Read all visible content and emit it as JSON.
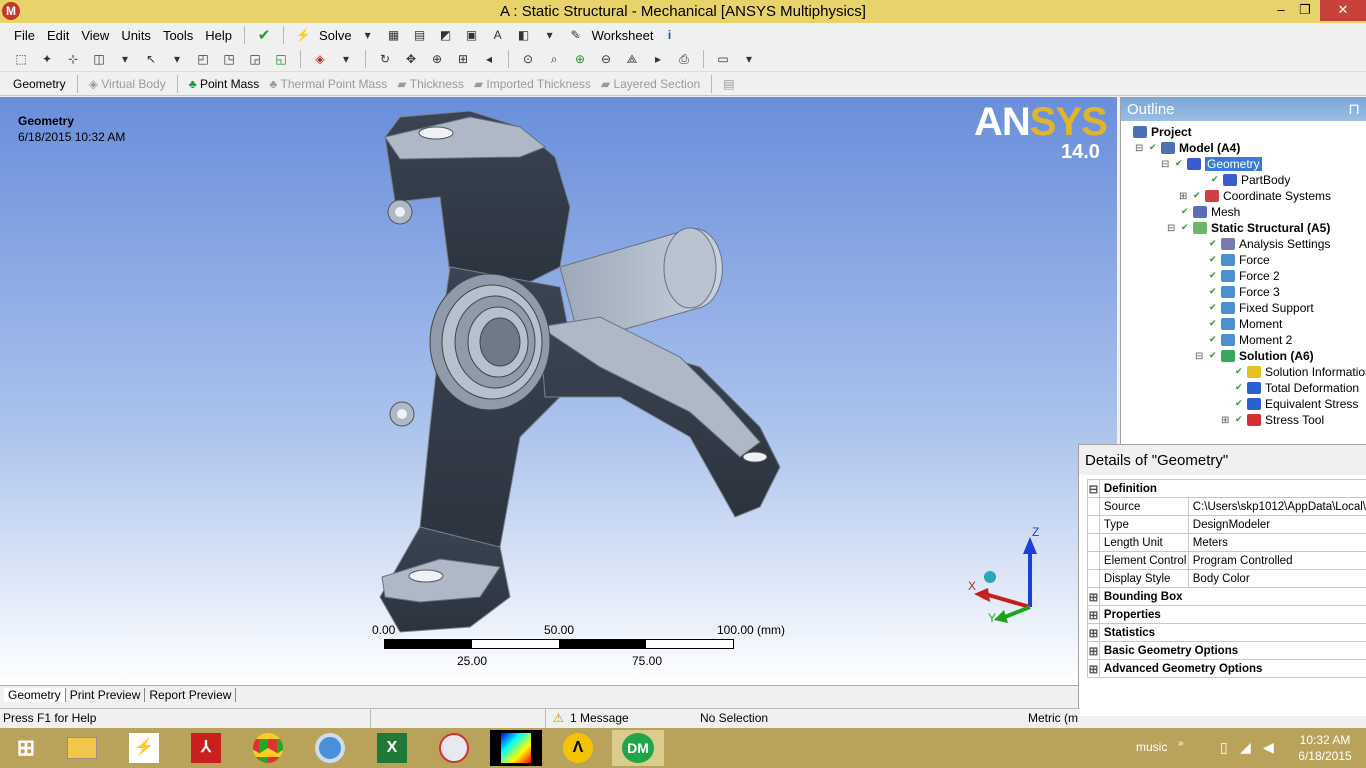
{
  "window": {
    "title": "A : Static Structural - Mechanical [ANSYS Multiphysics]",
    "minimize": "–",
    "maximize": "❐",
    "close": "✕"
  },
  "menu": [
    "File",
    "Edit",
    "View",
    "Units",
    "Tools",
    "Help"
  ],
  "toolbar1": {
    "solve_label": "Solve",
    "worksheet_label": "Worksheet"
  },
  "context": {
    "geometry": "Geometry",
    "virtual_body": "Virtual Body",
    "point_mass": "Point Mass",
    "thermal_point_mass": "Thermal Point Mass",
    "thickness": "Thickness",
    "imported_thickness": "Imported Thickness",
    "layered_section": "Layered Section"
  },
  "viewport": {
    "title": "Geometry",
    "date": "6/18/2015 10:32 AM",
    "brand_a": "AN",
    "brand_b": "SYS",
    "version": "14.0",
    "scale": {
      "top": [
        "0.00",
        "50.00",
        "100.00 (mm)"
      ],
      "bottom": [
        "25.00",
        "75.00"
      ]
    },
    "axes": {
      "z": "Z",
      "x": "X",
      "y": "Y"
    }
  },
  "tabs": [
    "Geometry",
    "Print Preview",
    "Report Preview"
  ],
  "outline": {
    "header": "Outline",
    "pin": "⊓",
    "tree": [
      {
        "label": "Project",
        "bold": true
      },
      {
        "label": "Model (A4)",
        "bold": true
      },
      {
        "label": "Geometry",
        "selected": true
      },
      {
        "label": "PartBody"
      },
      {
        "label": "Coordinate Systems"
      },
      {
        "label": "Mesh"
      },
      {
        "label": "Static Structural (A5)",
        "bold": true
      },
      {
        "label": "Analysis Settings"
      },
      {
        "label": "Force"
      },
      {
        "label": "Force 2"
      },
      {
        "label": "Force 3"
      },
      {
        "label": "Fixed Support"
      },
      {
        "label": "Moment"
      },
      {
        "label": "Moment 2"
      },
      {
        "label": "Solution (A6)",
        "bold": true
      },
      {
        "label": "Solution Information"
      },
      {
        "label": "Total Deformation"
      },
      {
        "label": "Equivalent Stress"
      },
      {
        "label": "Stress Tool"
      }
    ]
  },
  "details": {
    "header": "Details of \"Geometry\"",
    "definition": "Definition",
    "rows": [
      {
        "key": "Source",
        "value": "C:\\Users\\skp1012\\AppData\\Local\\"
      },
      {
        "key": "Type",
        "value": "DesignModeler"
      },
      {
        "key": "Length Unit",
        "value": "Meters"
      },
      {
        "key": "Element Control",
        "value": "Program Controlled"
      },
      {
        "key": "Display Style",
        "value": "Body Color"
      }
    ],
    "groups": [
      "Bounding Box",
      "Properties",
      "Statistics",
      "Basic Geometry Options",
      "Advanced Geometry Options"
    ]
  },
  "status": {
    "help": "Press F1 for Help",
    "messages": "1 Message",
    "selection": "No Selection",
    "units": "Metric (m"
  },
  "taskbar": {
    "music": "music",
    "time": "10:32 AM",
    "date": "6/18/2015",
    "apps": [
      "start-icon",
      "file-explorer-icon",
      "matlab-icon",
      "acrobat-icon",
      "chrome-icon",
      "chrome-alt-icon",
      "excel-icon",
      "paint-icon",
      "spectrum-app-icon",
      "ansys-workbench-icon",
      "design-modeler-icon"
    ],
    "dm_label": "DM",
    "excel_label": "X"
  },
  "colors": {
    "title_bar": "#e8d36a",
    "taskbar": "#b9a35a",
    "viewport_top": "#6a8edb",
    "selection": "#3a7ad8"
  }
}
